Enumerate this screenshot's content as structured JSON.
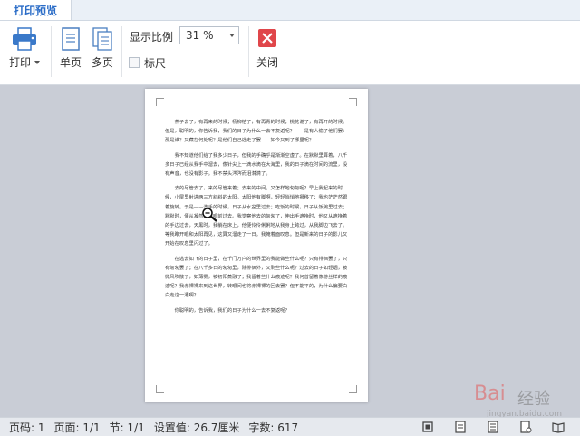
{
  "tabs": {
    "active": "打印预览"
  },
  "toolbar": {
    "print_label": "打印",
    "single_page_label": "单页",
    "multi_page_label": "多页",
    "zoom_label": "显示比例",
    "zoom_value": "31 %",
    "ruler_label": "标尺",
    "ruler_checked": false,
    "close_label": "关闭"
  },
  "document": {
    "paragraphs": [
      "燕子去了，有再来的时候；杨柳枯了，有再青的时候；桃花谢了，有再开的时候。但是，聪明的，你告诉我，我们的日子为什么一去不复返呢？——是有人偷了他们罢：那是谁？又藏在何处呢？是他们自己逃走了罢——如今又到了哪里呢？",
      "我不知道他们给了我多少日子，但我的手确乎是渐渐空虚了。在默默里算着，八千多日子已经从我手中溜去，像针尖上一滴水滴在大海里，我的日子滴在时间的流里，没有声音，也没有影子。我不禁头涔涔而泪潸潸了。",
      "去的尽管去了，来的尽管来着；去来的中间，又怎样地匆匆呢？早上我起来的时候，小屋里射进两三方斜斜的太阳。太阳他有脚啊，轻轻悄悄地挪移了；我也茫茫然跟着旋转。于是——洗手的时候，日子从水盆里过去；吃饭的时候，日子从饭碗里过去；默默时，便从凝然的双眼前过去。我觉察他去的匆匆了，伸出手遮挽时，他又从遮挽着的手边过去，天黑时，我躺在床上，他便伶伶俐俐地从我身上跨过，从我脚边飞去了。等我睁开眼和太阳再见，这算又溜走了一日。我掩着面叹息。但是新来的日子的影儿又开始在叹息里闪过了。",
      "在逃去如飞的日子里，在千门万户的世界里的我能做些什么呢？只有徘徊罢了，只有匆匆罢了；在八千多日的匆匆里，除徘徊外，又剩些什么呢？过去的日子如轻烟，被微风吹散了，如薄雾，被初阳蒸融了；我留着些什么痕迹呢？我何曾留着像游丝样的痕迹呢？我赤裸裸来到这世界，转眼间也将赤裸裸的回去罢？但不能平的，为什么偏要白白走这一遭啊？",
      "你聪明的，告诉我，我们的日子为什么一去不复返呢？"
    ]
  },
  "watermark": {
    "brand": "Bai",
    "brand_cn": "经验",
    "url": "jingyan.baidu.com"
  },
  "status": {
    "page_code": "页码: 1",
    "page": "页面: 1/1",
    "section": "节: 1/1",
    "setting": "设置值: 26.7厘米",
    "word_count": "字数: 617"
  },
  "colors": {
    "accent": "#2a6cc7",
    "close_red": "#e0464a",
    "canvas": "#c9cdd6"
  }
}
